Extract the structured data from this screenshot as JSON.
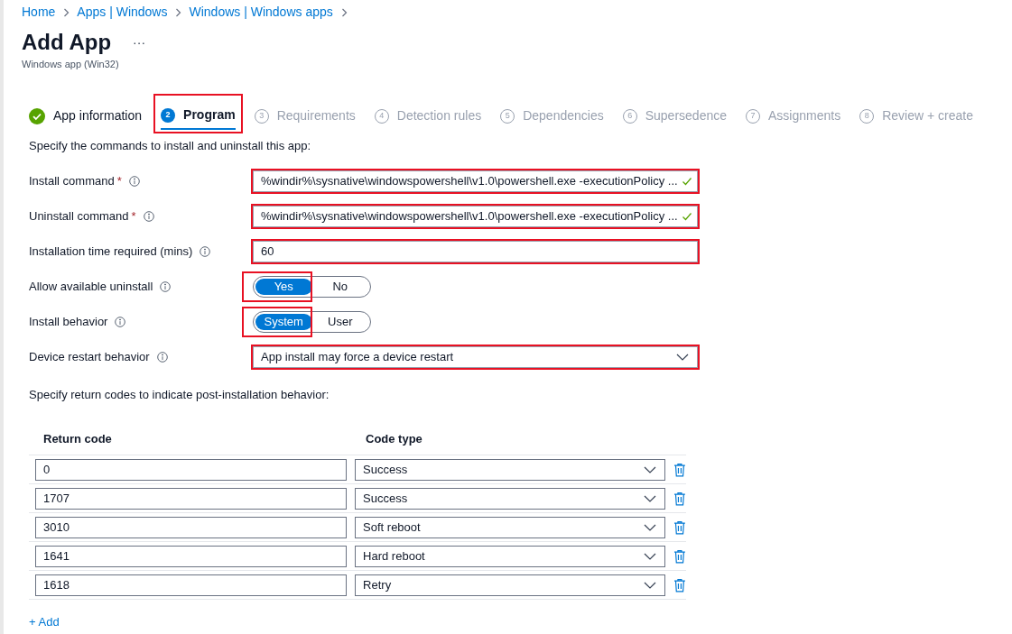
{
  "breadcrumb": [
    "Home",
    "Apps | Windows",
    "Windows | Windows apps"
  ],
  "page": {
    "title": "Add App",
    "more": "···",
    "subtitle": "Windows app (Win32)"
  },
  "steps": [
    {
      "label": "App information",
      "completed": true,
      "selected": false,
      "highlighted": false
    },
    {
      "number": "2",
      "label": "Program",
      "completed": false,
      "selected": true,
      "highlighted": true
    },
    {
      "number": "3",
      "label": "Requirements",
      "completed": false,
      "selected": false,
      "highlighted": false
    },
    {
      "number": "4",
      "label": "Detection rules",
      "completed": false,
      "selected": false,
      "highlighted": false
    },
    {
      "number": "5",
      "label": "Dependencies",
      "completed": false,
      "selected": false,
      "highlighted": false
    },
    {
      "number": "6",
      "label": "Supersedence",
      "completed": false,
      "selected": false,
      "highlighted": false
    },
    {
      "number": "7",
      "label": "Assignments",
      "completed": false,
      "selected": false,
      "highlighted": false
    },
    {
      "number": "8",
      "label": "Review + create",
      "completed": false,
      "selected": false,
      "highlighted": false
    }
  ],
  "intro": "Specify the commands to install and uninstall this app:",
  "fields": [
    {
      "kind": "text",
      "label": "Install command",
      "required_mark": "*",
      "value": "%windir%\\sysnative\\windowspowershell\\v1.0\\powershell.exe -executionPolicy ...",
      "valid": true,
      "highlighted": true
    },
    {
      "kind": "text",
      "label": "Uninstall command",
      "required_mark": "*",
      "value": "%windir%\\sysnative\\windowspowershell\\v1.0\\powershell.exe -executionPolicy ...",
      "valid": true,
      "highlighted": true
    },
    {
      "kind": "text",
      "label": "Installation time required (mins)",
      "value": "60",
      "valid": false,
      "highlighted": true
    },
    {
      "kind": "toggle",
      "label": "Allow available uninstall",
      "highlighted": true,
      "options": [
        {
          "label": "Yes",
          "selected": true
        },
        {
          "label": "No",
          "selected": false
        }
      ]
    },
    {
      "kind": "toggle",
      "label": "Install behavior",
      "highlighted": true,
      "options": [
        {
          "label": "System",
          "selected": true
        },
        {
          "label": "User",
          "selected": false
        }
      ]
    },
    {
      "kind": "select",
      "label": "Device restart behavior",
      "value": "App install may force a device restart",
      "highlighted": true
    }
  ],
  "return_codes": {
    "intro": "Specify return codes to indicate post-installation behavior:",
    "columns": [
      "Return code",
      "Code type"
    ],
    "rows": [
      {
        "code": "0",
        "type": "Success"
      },
      {
        "code": "1707",
        "type": "Success"
      },
      {
        "code": "3010",
        "type": "Soft reboot"
      },
      {
        "code": "1641",
        "type": "Hard reboot"
      },
      {
        "code": "1618",
        "type": "Retry"
      }
    ],
    "add": "+ Add"
  }
}
